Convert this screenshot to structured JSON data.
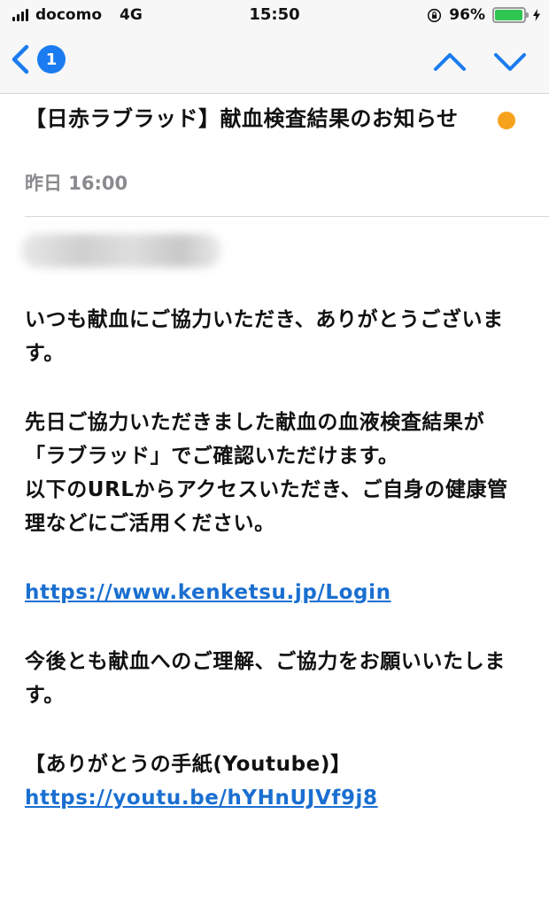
{
  "status_bar": {
    "carrier": "docomo",
    "network": "4G",
    "time": "15:50",
    "battery_percent": "96%",
    "battery_level": 0.96,
    "battery_color": "#2fc552"
  },
  "nav": {
    "back_badge": "1",
    "accent_color": "#1a7cf0"
  },
  "email": {
    "subject": "【日赤ラブラッド】献血検査結果のお知らせ",
    "date": "昨日 16:00",
    "unread_dot_color": "#f7a21c",
    "body": {
      "greeting": "いつも献血にご協力いただき、ありがとうございます。",
      "line1": "先日ご協力いただきました献血の血液検査結果が",
      "line2": "「ラブラッド」でご確認いただけます。",
      "line3": "以下のURLからアクセスいただき、ご自身の健康管理などにご活用ください。",
      "link1": "https://www.kenketsu.jp/Login",
      "closing": "今後とも献血へのご理解、ご協力をお願いいたします。",
      "letter_heading": "【ありがとうの手紙(Youtube)】",
      "link2": "https://youtu.be/hYHnUJVf9j8"
    }
  }
}
